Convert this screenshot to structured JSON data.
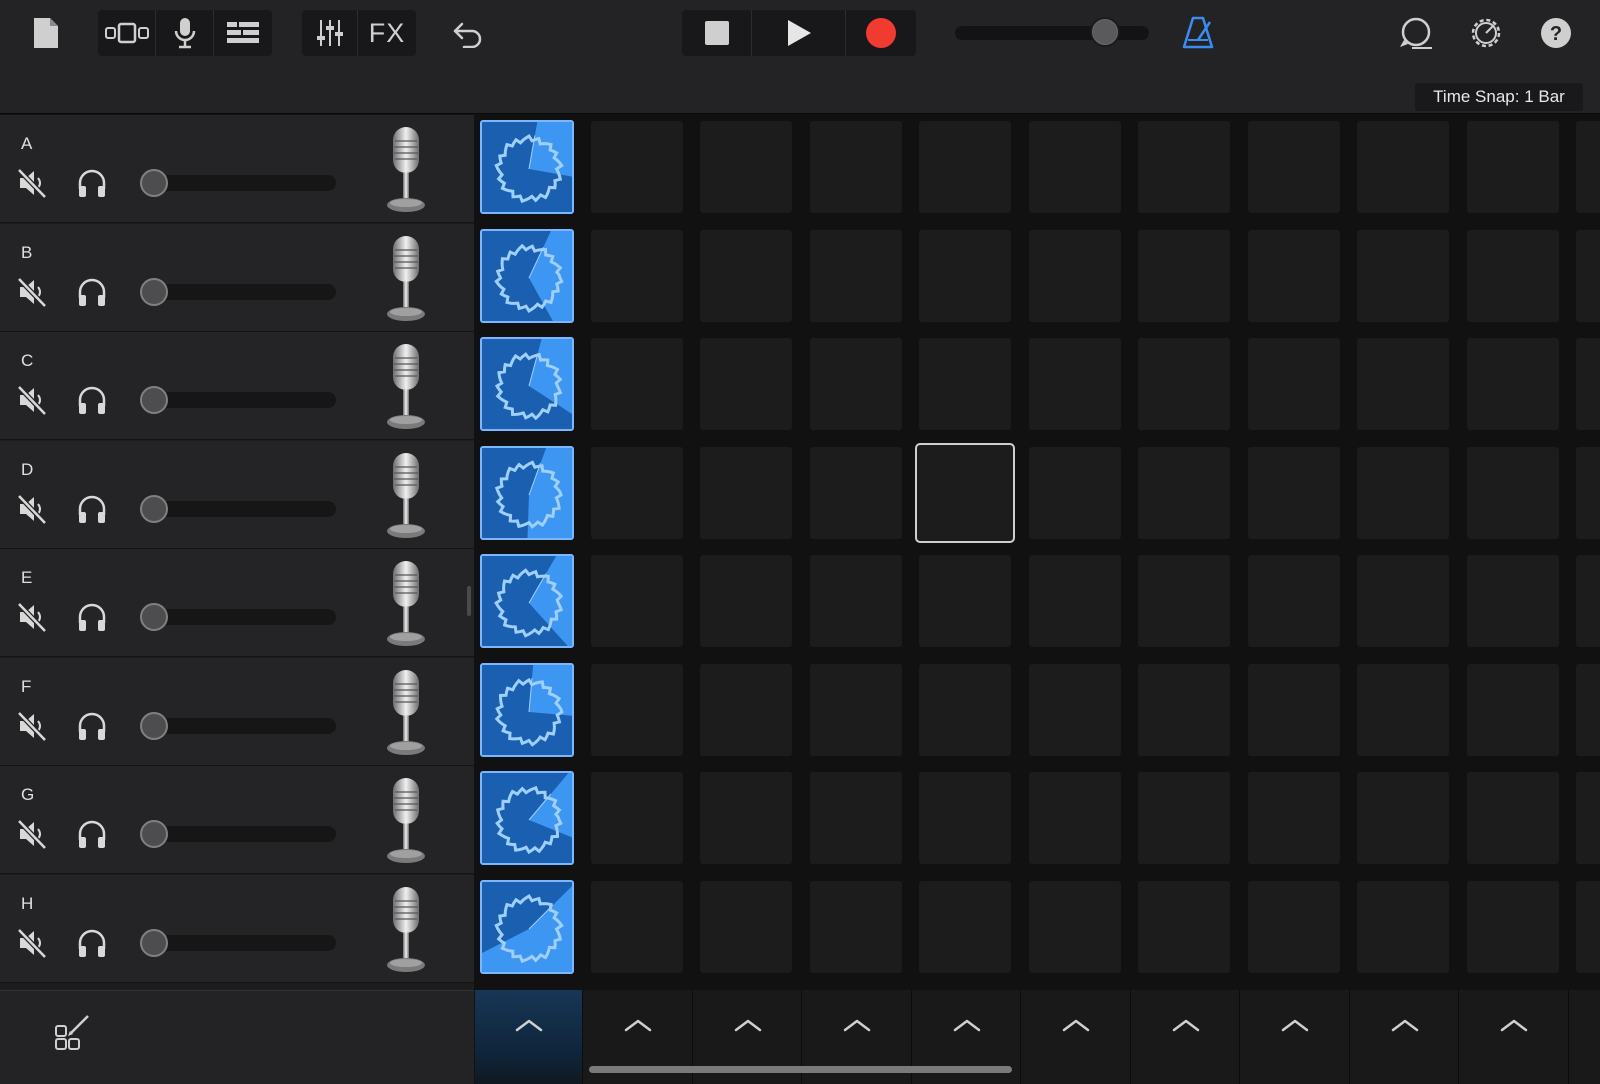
{
  "toolbar": {
    "fx_label": "FX",
    "time_snap": "Time Snap: 1 Bar",
    "metronome_color": "#3b8cf0",
    "record_color": "#f23b30",
    "tempo_level": 0.77,
    "icons": [
      "document-icon",
      "view-toggle-icon",
      "mic-icon",
      "tracks-list-icon",
      "mixer-icon",
      "fx-button",
      "undo-icon",
      "stop-icon",
      "play-icon",
      "record-icon",
      "master-volume-slider",
      "metronome-icon",
      "loop-browser-icon",
      "settings-icon",
      "help-icon"
    ]
  },
  "tracks": [
    {
      "letter": "A",
      "volume": 0.0
    },
    {
      "letter": "B",
      "volume": 0.0
    },
    {
      "letter": "C",
      "volume": 0.0
    },
    {
      "letter": "D",
      "volume": 0.0
    },
    {
      "letter": "E",
      "volume": 0.0
    },
    {
      "letter": "F",
      "volume": 0.0
    },
    {
      "letter": "G",
      "volume": 0.0
    },
    {
      "letter": "H",
      "volume": 0.0
    }
  ],
  "grid": {
    "columns_visible": 10,
    "filled_column": 1,
    "selected_cell": {
      "row": "D",
      "column": 5
    }
  },
  "colors": {
    "loop_blue": "#1a5fb0",
    "loop_light": "#3d96f2",
    "loop_wave": "#9fcffc"
  }
}
